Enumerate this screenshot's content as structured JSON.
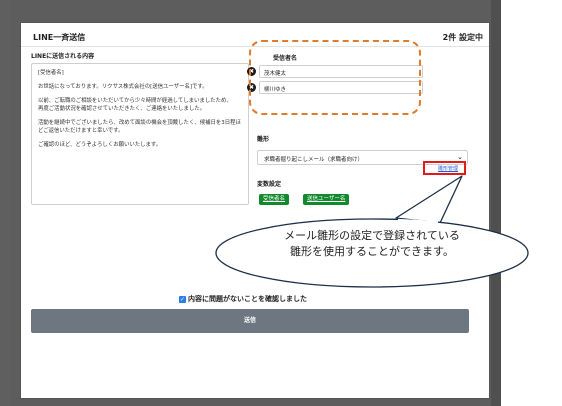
{
  "modal": {
    "title": "LINE一斉送信",
    "count": "2件 設定中",
    "message_label": "LINEに送信される内容",
    "message_paragraphs": [
      "[受信者名]",
      "お世話になっております。リクサス株式会社の[送信ユーザー名]です。",
      "以前、ご転職のご相談をいただいてから少々時間が経過してしまいましたため、\n再度ご活動状況を確認させていただきたく、ご連絡をいたしました。",
      "活動を継続中でございましたら、改めて面談の機会を頂戴したく、候補日を3日程ほどご返信いただけますと幸いです。",
      "ご確認のほど、どうぞよろしくお願いいたします。"
    ],
    "recipients_label": "受信者名",
    "recipients": [
      "茂木健太",
      "柳川ゆき"
    ],
    "remove_glyph": "✖",
    "template_label": "雛形",
    "template_value": "求職者掘り起こしメール（求職者向け）",
    "template_manage_link": "雛形管理",
    "variables_label": "変数設定",
    "variable_tags": [
      "受信者名",
      "送信ユーザー名"
    ],
    "confirm_text": "内容に問題がないことを確認しました",
    "confirm_checked": true,
    "send_label": "送信"
  },
  "annotation": {
    "callout_lines": [
      "メール雛形の設定で登録されている",
      "雛形を使用することができます。"
    ],
    "dashed_color": "#e07b2c",
    "highlight_color": "#e01b1b"
  },
  "icons": {
    "remove": "remove-icon",
    "chevron": "chevron-down-icon",
    "check": "checkbox-checked-icon"
  }
}
